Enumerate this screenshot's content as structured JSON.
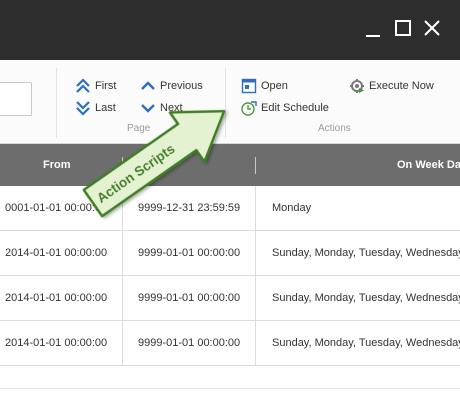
{
  "ribbon": {
    "page_group": {
      "first": "First",
      "last": "Last",
      "previous": "Previous",
      "next": "Next",
      "label": "Page"
    },
    "actions_group": {
      "open": "Open",
      "edit_schedule": "Edit Schedule",
      "execute_now": "Execute Now",
      "label": "Actions"
    }
  },
  "table": {
    "columns": [
      "From",
      "On Week Day"
    ],
    "rows": [
      {
        "from": "0001-01-01 00:00:00",
        "to": "9999-12-31 23:59:59",
        "weekday": "Monday"
      },
      {
        "from": "2014-01-01 00:00:00",
        "to": "9999-01-01 00:00:00",
        "weekday": "Sunday, Monday, Tuesday, Wednesday"
      },
      {
        "from": "2014-01-01 00:00:00",
        "to": "9999-01-01 00:00:00",
        "weekday": "Sunday, Monday, Tuesday, Wednesday"
      },
      {
        "from": "2014-01-01 00:00:00",
        "to": "9999-01-01 00:00:00",
        "weekday": "Sunday, Monday, Tuesday, Wednesday"
      }
    ]
  },
  "callout": {
    "text": "Action Scripts"
  },
  "colors": {
    "titlebar": "#2d2d2d",
    "header": "#6d6d6d",
    "arrow_blue": "#2b6fbf",
    "callout_fill": "#e4f2d2",
    "callout_border": "#3f7e22"
  },
  "icons": {
    "first": "double-chevron-up-icon",
    "last": "double-chevron-down-icon",
    "previous": "chevron-up-icon",
    "next": "chevron-down-icon",
    "open": "open-window-icon",
    "edit_schedule": "edit-schedule-icon",
    "execute_now": "execute-now-icon"
  }
}
